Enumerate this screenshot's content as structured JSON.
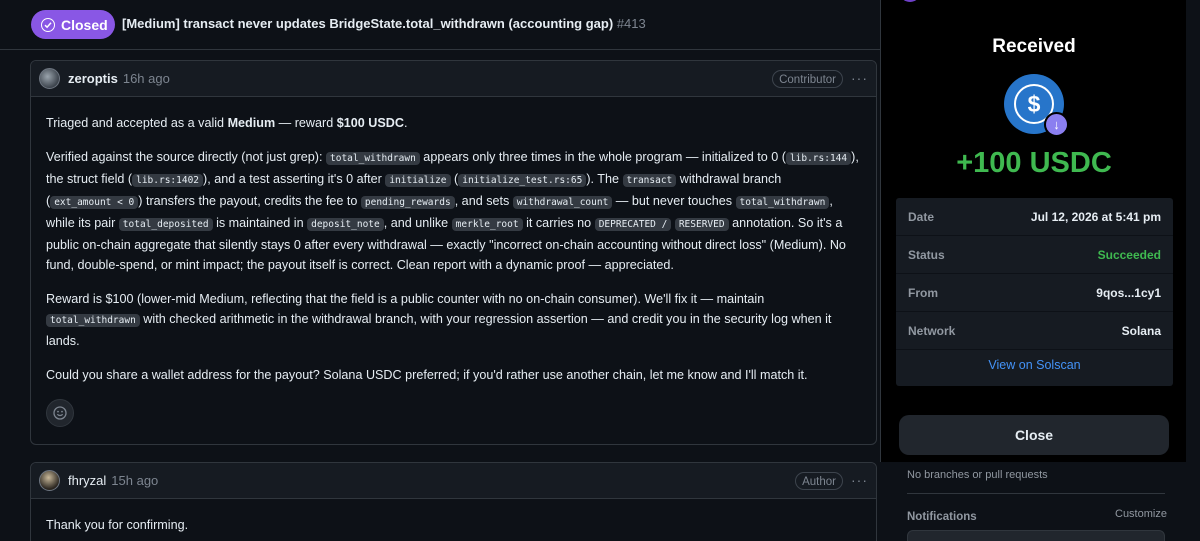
{
  "header": {
    "state": "Closed",
    "title": "[Medium] transact never updates BridgeState.total_withdrawn (accounting gap)",
    "number": "#413"
  },
  "comment1": {
    "author": "zeroptis",
    "time": "16h ago",
    "role": "Contributor",
    "menu": "···"
  },
  "comment2": {
    "author": "fhryzal",
    "time": "15h ago",
    "role": "Author",
    "menu": "···",
    "body": "Thank you for confirming."
  },
  "modal": {
    "title": "Received",
    "coin_symbol": "$",
    "amount": "+100 USDC",
    "rows": [
      {
        "key": "Date",
        "value": "Jul 12, 2026 at 5:41 pm"
      },
      {
        "key": "Status",
        "value": "Succeeded"
      },
      {
        "key": "From",
        "value": "9qos...1cy1"
      },
      {
        "key": "Network",
        "value": "Solana"
      }
    ],
    "link": "View on Solscan",
    "close": "Close",
    "status_color": "#3fb950",
    "amount_color": "#3fb950"
  },
  "sidebar": {
    "development": "No branches or pull requests",
    "notifications": "Notifications",
    "customize": "Customize"
  },
  "colors": {
    "closed_badge": "#8957e5",
    "link": "#4493f8",
    "usdc_blue": "#2775ca"
  }
}
